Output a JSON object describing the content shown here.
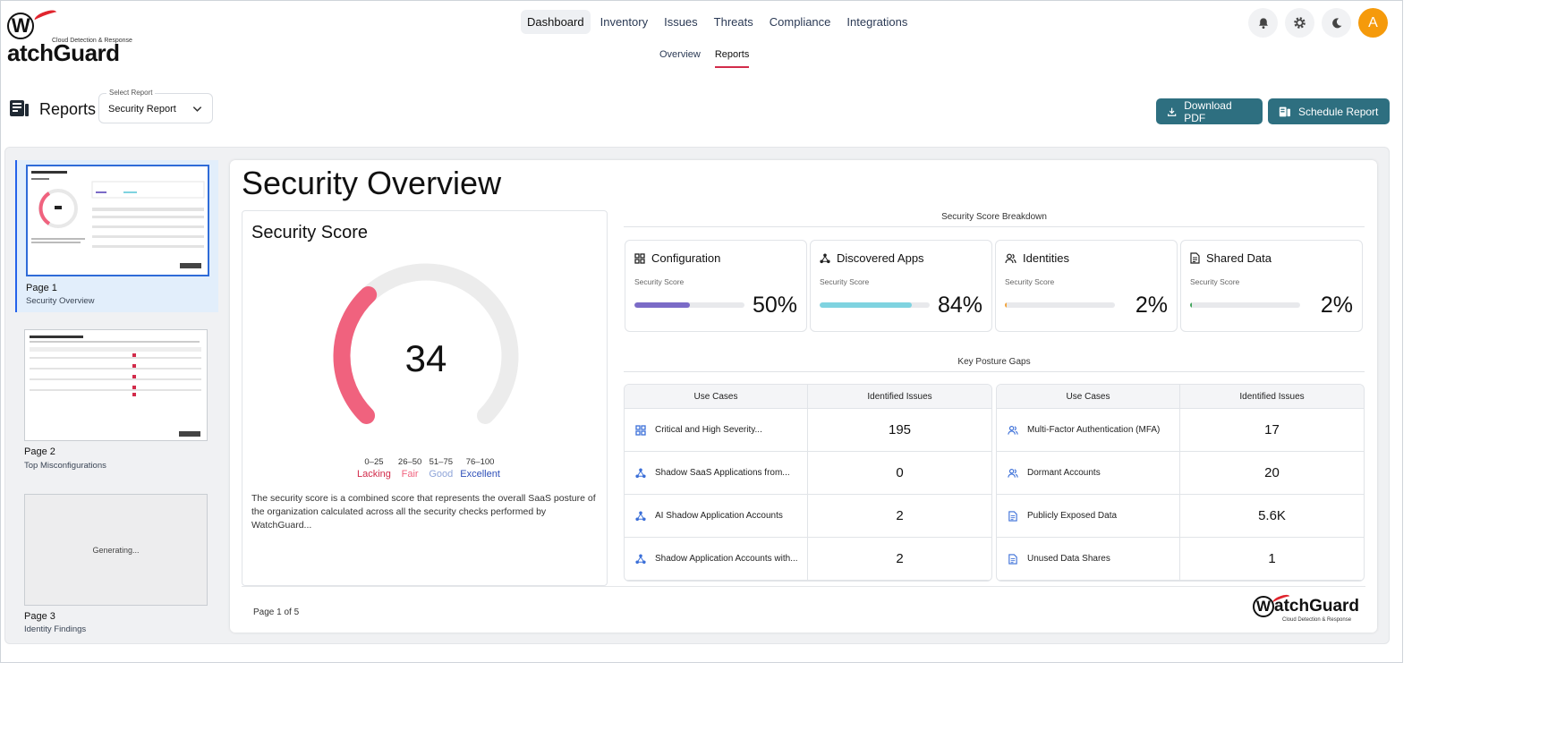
{
  "app": {
    "logo_text": "atchGuard",
    "logo_letter": "W",
    "logo_sub": "Cloud Detection & Response"
  },
  "nav": {
    "items": [
      {
        "label": "Dashboard",
        "active": true
      },
      {
        "label": "Inventory",
        "active": false
      },
      {
        "label": "Issues",
        "active": false
      },
      {
        "label": "Threats",
        "active": false
      },
      {
        "label": "Compliance",
        "active": false
      },
      {
        "label": "Integrations",
        "active": false
      }
    ],
    "sub": [
      {
        "label": "Overview",
        "active": false
      },
      {
        "label": "Reports",
        "active": true
      }
    ],
    "avatar_initial": "A"
  },
  "header": {
    "title": "Reports",
    "select_label": "Select Report",
    "select_value": "Security Report",
    "download_label": "Download PDF",
    "schedule_label": "Schedule Report"
  },
  "thumbnails": [
    {
      "page": "Page 1",
      "name": "Security Overview",
      "selected": true,
      "generating": false
    },
    {
      "page": "Page 2",
      "name": "Top Misconfigurations",
      "selected": false,
      "generating": false
    },
    {
      "page": "Page 3",
      "name": "Identity Findings",
      "selected": false,
      "generating": true,
      "status": "Generating..."
    }
  ],
  "report": {
    "title": "Security Overview",
    "score_title": "Security Score",
    "score": "34",
    "score_value": 34,
    "legend": [
      {
        "range": "0–25",
        "label": "Lacking",
        "color": "#d22b4a"
      },
      {
        "range": "26–50",
        "label": "Fair",
        "color": "#f0627e"
      },
      {
        "range": "51–75",
        "label": "Good",
        "color": "#8ea4d8"
      },
      {
        "range": "76–100",
        "label": "Excellent",
        "color": "#2e4fb8"
      }
    ],
    "score_description": "The security score is a combined score that represents the overall SaaS posture of the organization calculated across all the security checks performed by WatchGuard...",
    "breakdown_title": "Security Score Breakdown",
    "breakdown": [
      {
        "title": "Configuration",
        "label": "Security Score",
        "pct": "50%",
        "value": 50,
        "color": "#7b6bc7",
        "icon": "grid-icon"
      },
      {
        "title": "Discovered Apps",
        "label": "Security Score",
        "pct": "84%",
        "value": 84,
        "color": "#7fd3e0",
        "icon": "apps-icon"
      },
      {
        "title": "Identities",
        "label": "Security Score",
        "pct": "2%",
        "value": 2,
        "color": "#f3a33a",
        "icon": "users-icon"
      },
      {
        "title": "Shared Data",
        "label": "Security Score",
        "pct": "2%",
        "value": 2,
        "color": "#3fa55a",
        "icon": "document-icon"
      }
    ],
    "gaps_title": "Key Posture Gaps",
    "table_headers": {
      "use_cases": "Use Cases",
      "issues": "Identified Issues"
    },
    "gaps_left": [
      {
        "use_case": "Critical and High Severity...",
        "issues": "195",
        "icon": "grid-icon"
      },
      {
        "use_case": "Shadow SaaS Applications from...",
        "issues": "0",
        "icon": "apps-icon"
      },
      {
        "use_case": "AI Shadow Application Accounts",
        "issues": "2",
        "icon": "apps-icon"
      },
      {
        "use_case": "Shadow Application Accounts with...",
        "issues": "2",
        "icon": "apps-icon"
      }
    ],
    "gaps_right": [
      {
        "use_case": "Multi-Factor Authentication (MFA)",
        "issues": "17",
        "icon": "users-icon"
      },
      {
        "use_case": "Dormant Accounts",
        "issues": "20",
        "icon": "users-icon"
      },
      {
        "use_case": "Publicly Exposed Data",
        "issues": "5.6K",
        "icon": "document-icon"
      },
      {
        "use_case": "Unused Data Shares",
        "issues": "1",
        "icon": "document-icon"
      }
    ],
    "page_indicator": "Page 1 of 5"
  }
}
